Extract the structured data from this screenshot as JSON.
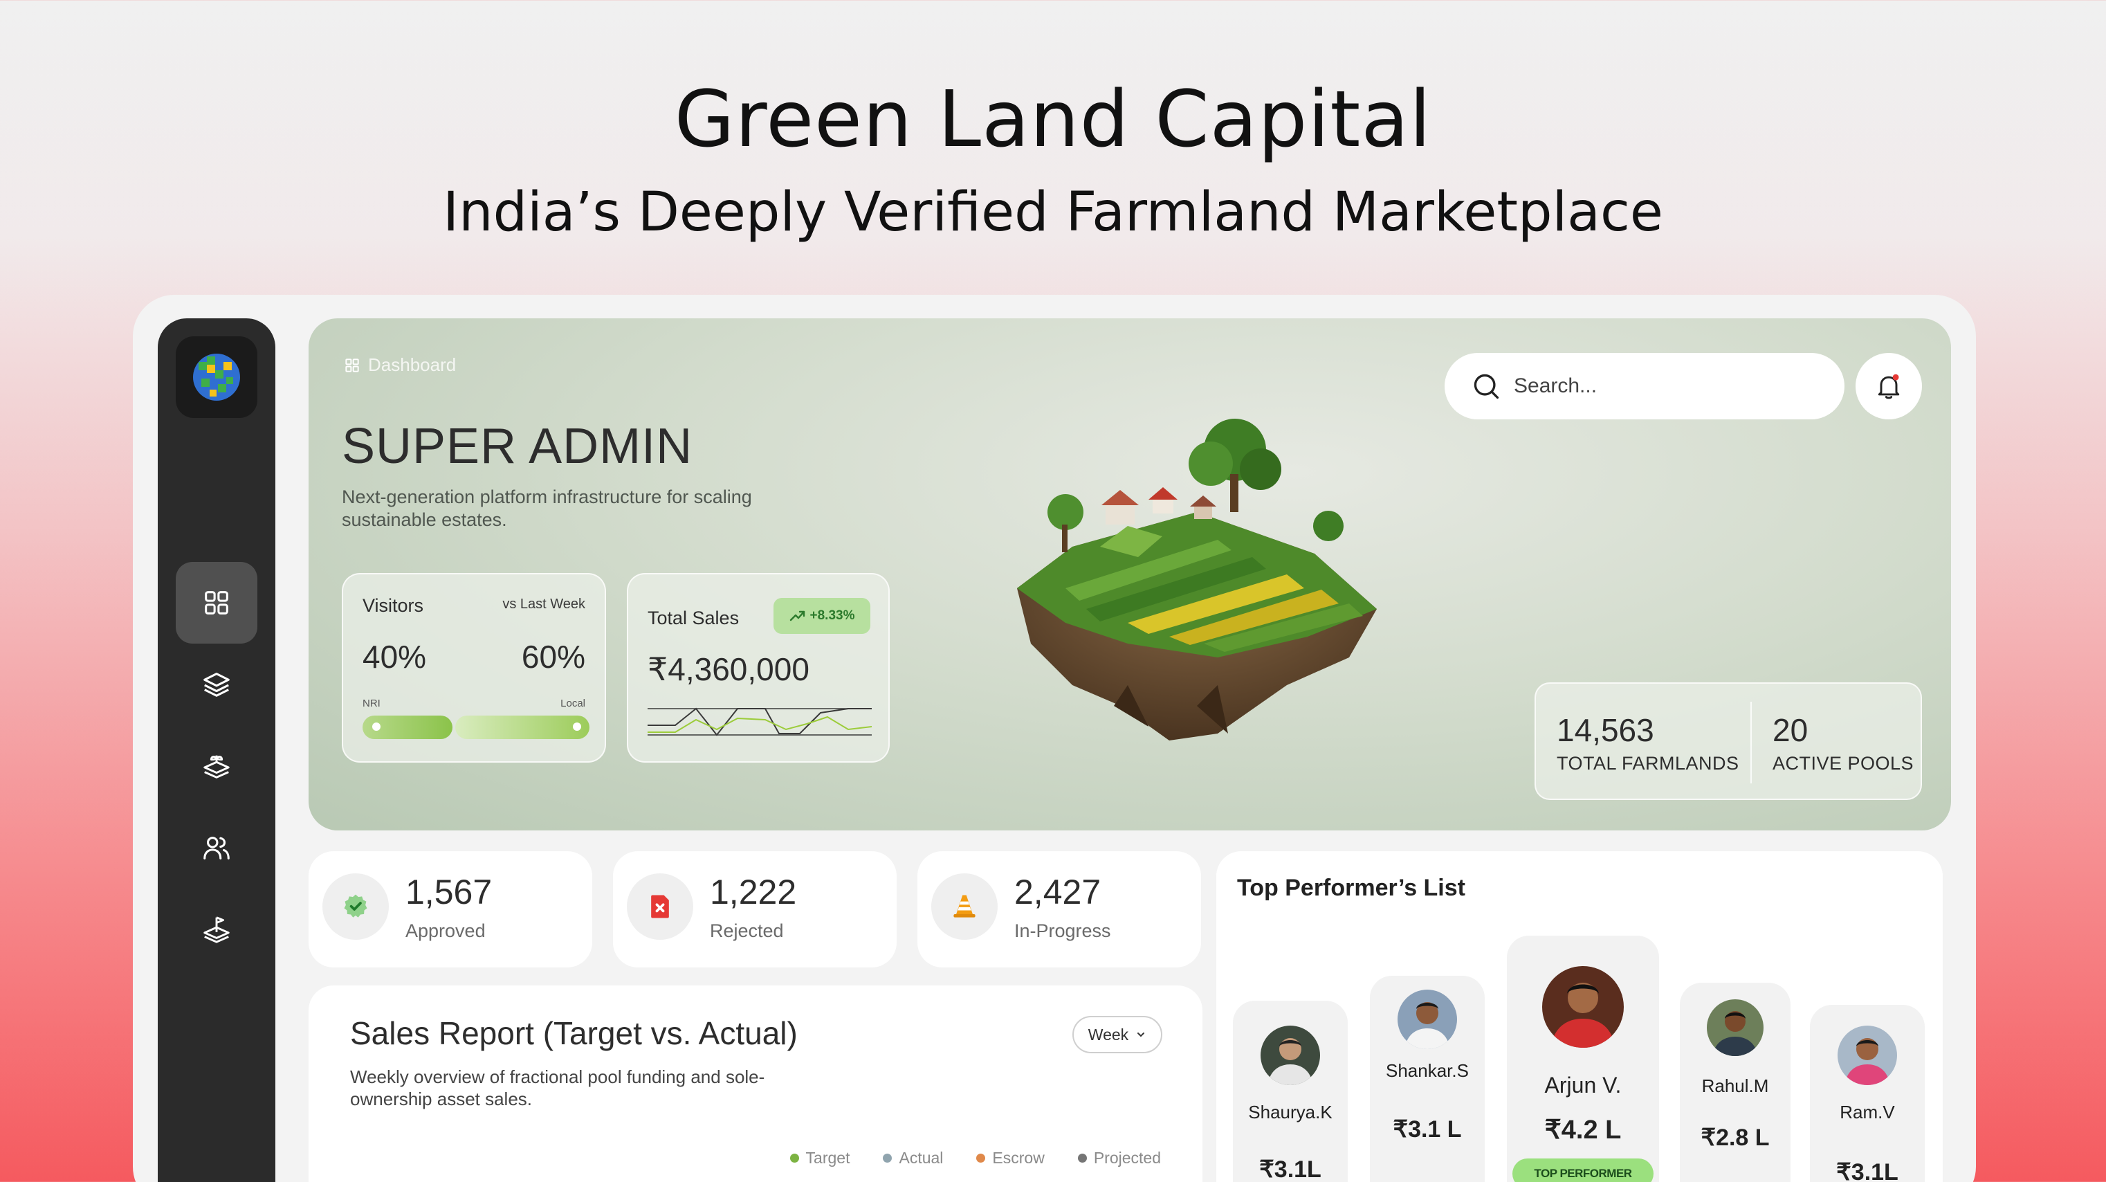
{
  "header": {
    "title": "Green Land Capital",
    "subtitle": "India’s Deeply Verified Farmland Marketplace"
  },
  "sidebar": {
    "items": [
      {
        "icon": "grid-icon",
        "active": true
      },
      {
        "icon": "layers-icon",
        "active": false
      },
      {
        "icon": "land-stack-icon",
        "active": false
      },
      {
        "icon": "users-icon",
        "active": false
      },
      {
        "icon": "plot-flag-icon",
        "active": false
      }
    ]
  },
  "hero": {
    "breadcrumb": "Dashboard",
    "title": "SUPER ADMIN",
    "description": "Next-generation platform infrastructure for scaling sustainable estates."
  },
  "visitors": {
    "title": "Visitors",
    "comparison": "vs Last Week",
    "nri_percent": "40%",
    "local_percent": "60%",
    "nri_label": "NRI",
    "local_label": "Local",
    "nri_share": 0.4,
    "local_share": 0.6
  },
  "total_sales": {
    "title": "Total Sales",
    "change": "+8.33%",
    "value": "₹4,360,000"
  },
  "search": {
    "placeholder": "Search..."
  },
  "stats": {
    "farmlands_value": "14,563",
    "farmlands_label": "TOTAL FARMLANDS",
    "pools_value": "20",
    "pools_label": "ACTIVE POOLS"
  },
  "kpis": [
    {
      "value": "1,567",
      "label": "Approved",
      "icon": "verified-shield-icon",
      "color": "#3fae49"
    },
    {
      "value": "1,222",
      "label": "Rejected",
      "icon": "rejected-x-icon",
      "color": "#e53935"
    },
    {
      "value": "2,427",
      "label": "In-Progress",
      "icon": "traffic-cone-icon",
      "color": "#f39c12"
    }
  ],
  "sales_report": {
    "title": "Sales Report (Target vs. Actual)",
    "description": "Weekly overview of fractional pool funding and sole-ownership asset sales.",
    "period": "Week",
    "legend": [
      {
        "label": "Target",
        "color": "#7cb342"
      },
      {
        "label": "Actual",
        "color": "#90a4ae"
      },
      {
        "label": "Escrow",
        "color": "#e0894a"
      },
      {
        "label": "Projected",
        "color": "#757575"
      }
    ]
  },
  "performers": {
    "title": "Top Performer’s List",
    "badge": "TOP PERFORMER",
    "list": [
      {
        "name": "Shaurya.K",
        "value": "₹3.1L"
      },
      {
        "name": "Shankar.S",
        "value": "₹3.1 L"
      },
      {
        "name": "Arjun V.",
        "value": "₹4.2 L",
        "top": true
      },
      {
        "name": "Rahul.M",
        "value": "₹2.8 L"
      },
      {
        "name": "Ram.V",
        "value": "₹3.1L"
      }
    ]
  }
}
